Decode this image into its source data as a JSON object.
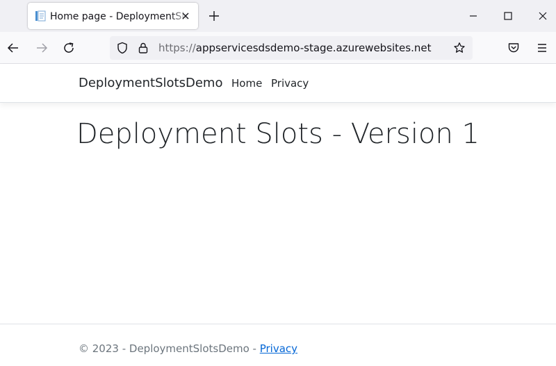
{
  "browser": {
    "tab": {
      "title": "Home page - DeploymentSlotsDemo",
      "favicon_icon": "document-favicon-icon",
      "close_icon": "close-icon"
    },
    "new_tab_icon": "plus-icon",
    "window_controls": [
      "minimize-icon",
      "maximize-icon",
      "close-window-icon"
    ],
    "toolbar_icons": [
      "back-arrow-icon",
      "forward-arrow-icon",
      "reload-icon",
      "shield-icon",
      "lock-icon",
      "bookmark-star-icon",
      "pocket-icon",
      "menu-hamburger-icon"
    ],
    "address": {
      "scheme": "https://",
      "host": "appservicesdsdemo-stage.azurewebsites.net"
    },
    "colors": {
      "chrome_bg": "#f0f0f4",
      "toolbar_bg": "#f9f9fb",
      "link": "#0366d6"
    }
  },
  "site": {
    "brand": "DeploymentSlotsDemo",
    "nav": [
      {
        "label": "Home"
      },
      {
        "label": "Privacy"
      }
    ],
    "heading": "Deployment Slots - Version 1",
    "footer": {
      "text": "© 2023 - DeploymentSlotsDemo - ",
      "link_label": "Privacy"
    }
  }
}
